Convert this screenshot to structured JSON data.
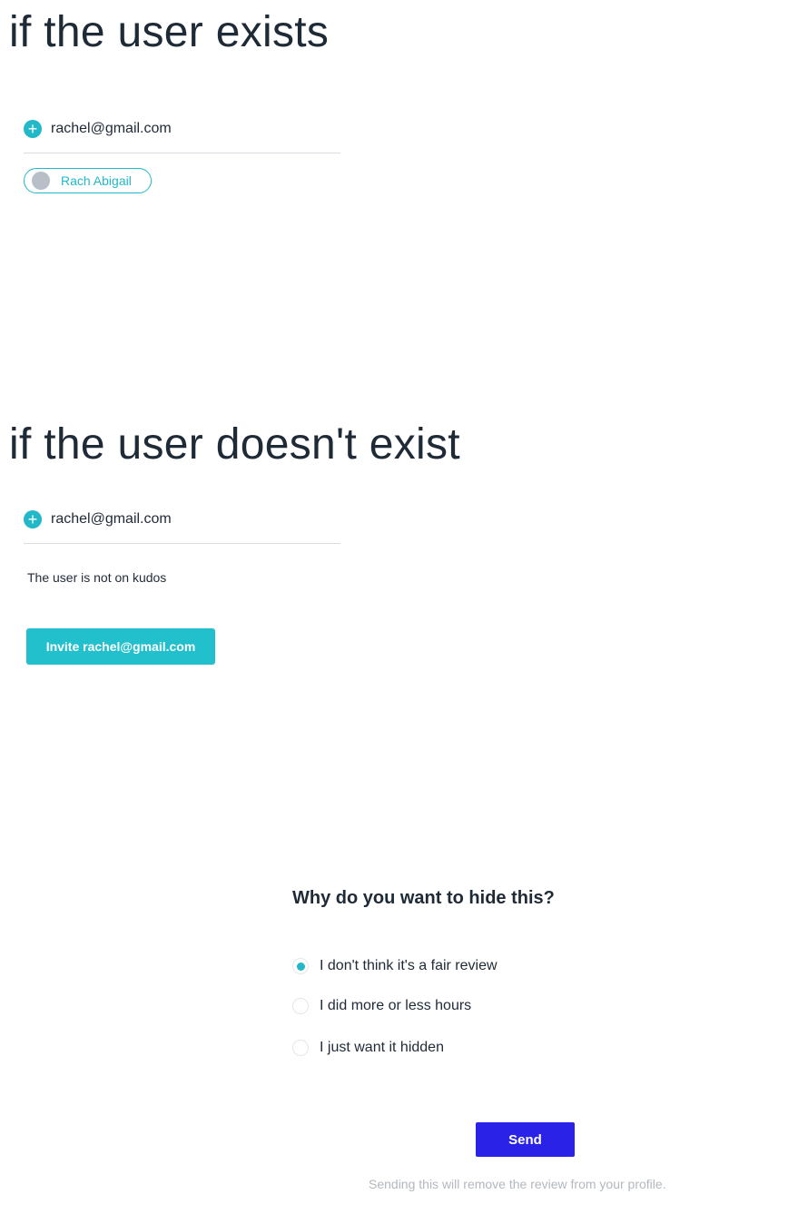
{
  "exists_section": {
    "heading": "if the user exists",
    "email_value": "rachel@gmail.com",
    "chip_label": "Rach Abigail"
  },
  "not_exists_section": {
    "heading": "if the user doesn't exist",
    "email_value": "rachel@gmail.com",
    "note": "The user is not on kudos",
    "invite_label": "Invite rachel@gmail.com"
  },
  "hide_dialog": {
    "question": "Why do you want to hide this?",
    "options": [
      {
        "label": "I don't think it's a fair review",
        "selected": true
      },
      {
        "label": "I did more or less hours",
        "selected": false
      },
      {
        "label": "I just want it hidden",
        "selected": false
      }
    ],
    "send_label": "Send",
    "footnote": "Sending this will remove the review from your profile."
  },
  "icons": {
    "add": "plus-circle-icon",
    "avatar": "avatar-placeholder"
  },
  "colors": {
    "accent": "#22b8c7",
    "primary_button": "#2a22e6",
    "text": "#1f2a37",
    "muted": "#b3b8be"
  }
}
